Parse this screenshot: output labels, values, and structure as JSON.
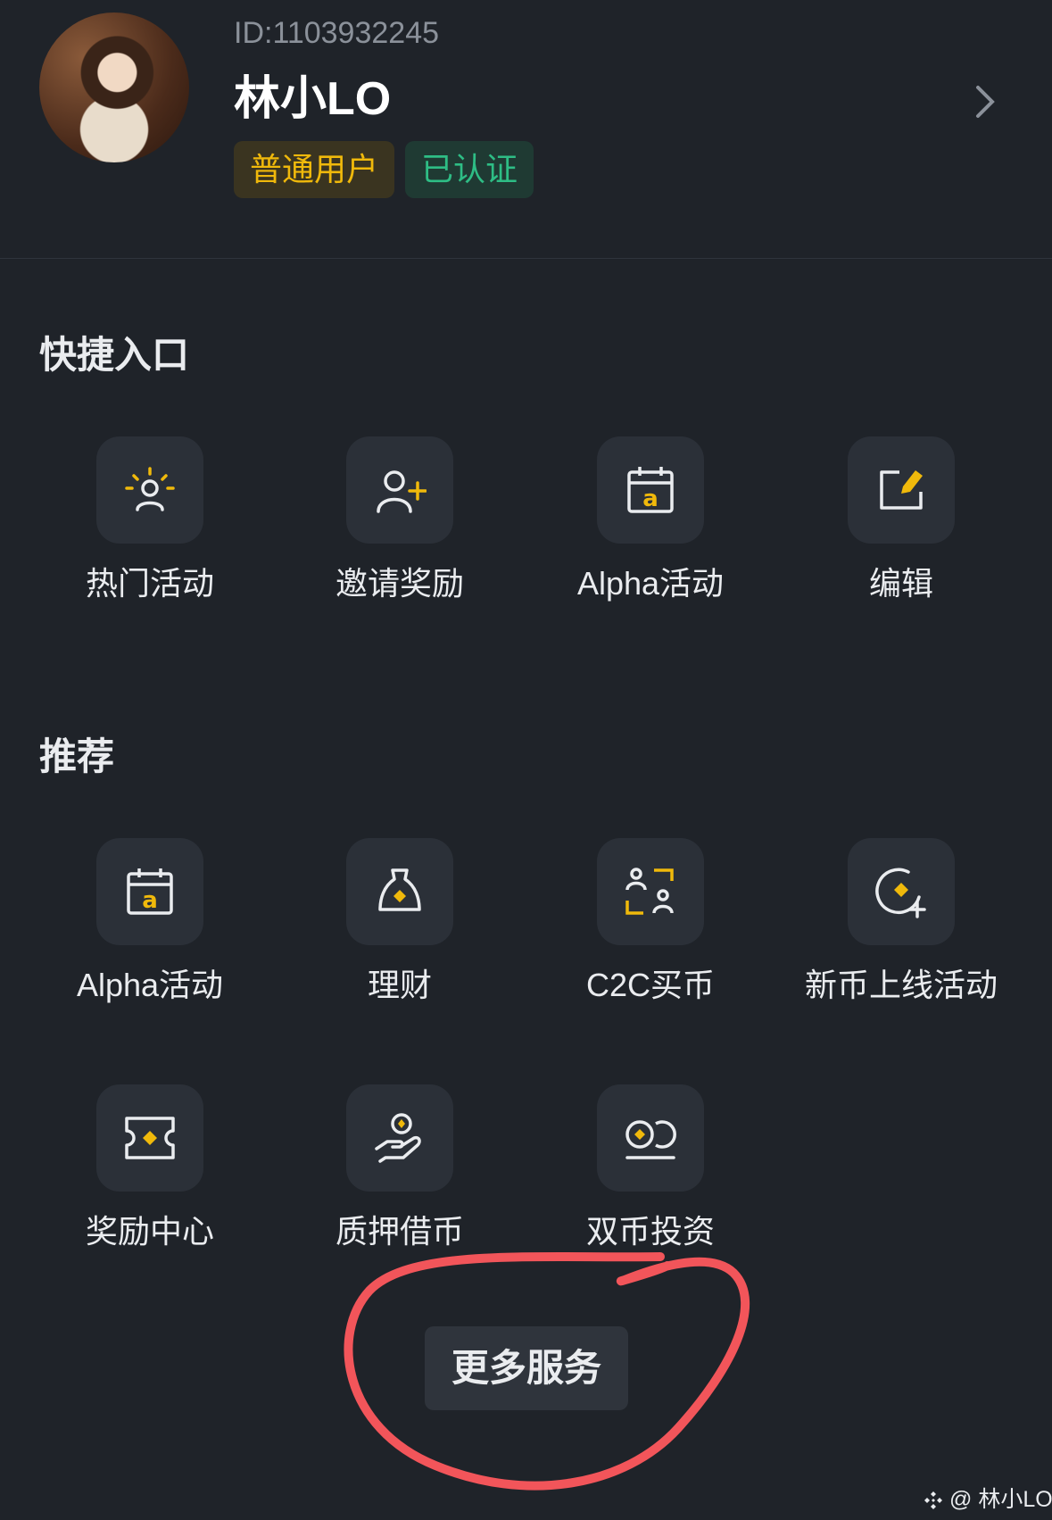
{
  "profile": {
    "id_text": "ID:1103932245",
    "name": "林小LO",
    "badges": {
      "user_type": "普通用户",
      "verification": "已认证"
    }
  },
  "quick_access": {
    "title": "快捷入口",
    "items": [
      {
        "label": "热门活动",
        "icon": "hot-activity-icon"
      },
      {
        "label": "邀请奖励",
        "icon": "invite-reward-icon"
      },
      {
        "label": "Alpha活动",
        "icon": "alpha-calendar-icon"
      },
      {
        "label": "编辑",
        "icon": "edit-icon"
      }
    ]
  },
  "recommended": {
    "title": "推荐",
    "items": [
      {
        "label": "Alpha活动",
        "icon": "alpha-calendar-icon"
      },
      {
        "label": "理财",
        "icon": "money-bag-icon"
      },
      {
        "label": "C2C买币",
        "icon": "c2c-users-icon"
      },
      {
        "label": "新币上线活动",
        "icon": "new-coin-icon"
      },
      {
        "label": "奖励中心",
        "icon": "ticket-icon"
      },
      {
        "label": "质押借币",
        "icon": "loan-hand-icon"
      },
      {
        "label": "双币投资",
        "icon": "dual-coin-icon"
      }
    ]
  },
  "more_services_label": "更多服务",
  "watermark": "@ 林小LO",
  "colors": {
    "accent": "#f0b90b",
    "verified": "#2ebd85",
    "background": "#1f2329",
    "tile": "#2b3038",
    "annotation": "#f2555a"
  }
}
